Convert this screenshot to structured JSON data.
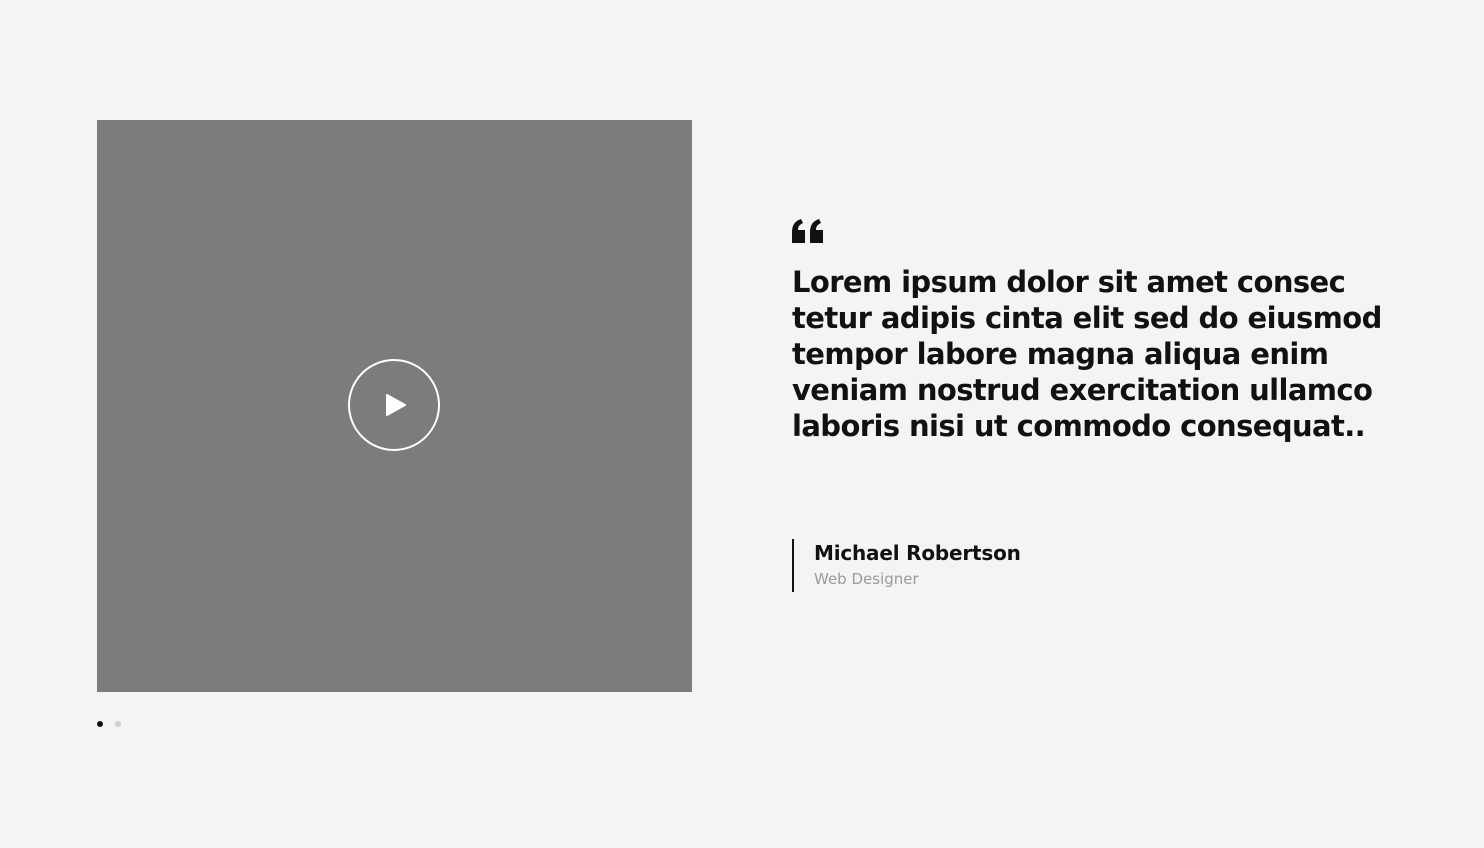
{
  "testimonial": {
    "video": {
      "play_icon": "play-icon",
      "panel_color": "#7b7c7e"
    },
    "quote_icon": "quote-icon",
    "quote": "Lorem ipsum dolor sit amet consec tetur adipis cinta elit sed do eiusmod tempor labore magna aliqua enim veniam nostrud exercitation ullamco laboris nisi ut commodo consequat..",
    "author": {
      "name": "Michael Robertson",
      "role": "Web Designer"
    },
    "pagination": {
      "total": 2,
      "active_index": 0
    }
  }
}
